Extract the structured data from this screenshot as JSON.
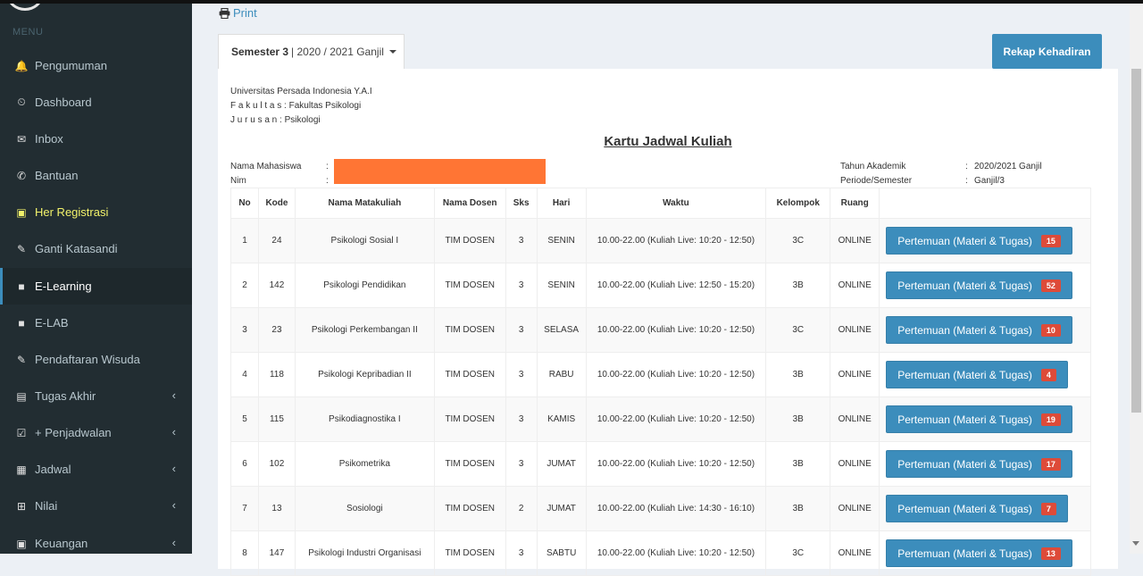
{
  "sidebar": {
    "header": "MENU",
    "items": [
      {
        "label": "Pengumuman",
        "icon": "bell-icon",
        "glyph": "🔔"
      },
      {
        "label": "Dashboard",
        "icon": "dashboard-icon",
        "glyph": "⏲"
      },
      {
        "label": "Inbox",
        "icon": "envelope-icon",
        "glyph": "✉"
      },
      {
        "label": "Bantuan",
        "icon": "phone-icon",
        "glyph": "✆"
      },
      {
        "label": "Her Registrasi",
        "icon": "money-icon",
        "glyph": "▣"
      },
      {
        "label": "Ganti Katasandi",
        "icon": "pencil-icon",
        "glyph": "✎"
      },
      {
        "label": "E-Learning",
        "icon": "video-camera-icon",
        "glyph": "■"
      },
      {
        "label": "E-LAB",
        "icon": "video-camera-icon",
        "glyph": "■"
      },
      {
        "label": "Pendaftaran Wisuda",
        "icon": "pencil-icon",
        "glyph": "✎"
      },
      {
        "label": "Tugas Akhir",
        "icon": "book-icon",
        "glyph": "▤"
      },
      {
        "label": "+ Penjadwalan",
        "icon": "calendar-check-icon",
        "glyph": "☑"
      },
      {
        "label": "Jadwal",
        "icon": "calendar-icon",
        "glyph": "▦"
      },
      {
        "label": "Nilai",
        "icon": "table-icon",
        "glyph": "⊞"
      },
      {
        "label": "Keuangan",
        "icon": "money-icon",
        "glyph": "▣"
      }
    ]
  },
  "toolbar": {
    "print_label": "Print",
    "rekap_label": "Rekap Kehadiran"
  },
  "semester_tab": {
    "semester": "Semester 3",
    "period": "| 2020 / 2021 Ganjil"
  },
  "university": {
    "name": "Universitas Persada Indonesia Y.A.I",
    "fakultas_label": "F a k u l t a s",
    "fakultas_value": ": Fakultas Psikologi",
    "jurusan_label": "J u r u s a n",
    "jurusan_value": ": Psikologi"
  },
  "card_title": "Kartu Jadwal Kuliah",
  "student": {
    "nama_label": "Nama Mahasiswa",
    "nim_label": "Nim",
    "colon": ":",
    "tahun_label": "Tahun Akademik",
    "tahun_value": "2020/2021 Ganjil",
    "periode_label": "Periode/Semester",
    "periode_value": "Ganjil/3"
  },
  "table": {
    "headers": [
      "No",
      "Kode",
      "Nama Matakuliah",
      "Nama Dosen",
      "Sks",
      "Hari",
      "Waktu",
      "Kelompok",
      "Ruang",
      ""
    ],
    "button_label": "Pertemuan (Materi & Tugas)",
    "rows": [
      {
        "no": "1",
        "kode": "24",
        "nama": "Psikologi Sosial I",
        "dosen": "TIM DOSEN",
        "sks": "3",
        "hari": "SENIN",
        "waktu": "10.00-22.00 (Kuliah Live: 10:20 - 12:50)",
        "kelompok": "3C",
        "ruang": "ONLINE",
        "badge": "15"
      },
      {
        "no": "2",
        "kode": "142",
        "nama": "Psikologi Pendidikan",
        "dosen": "TIM DOSEN",
        "sks": "3",
        "hari": "SENIN",
        "waktu": "10.00-22.00 (Kuliah Live: 12:50 - 15:20)",
        "kelompok": "3B",
        "ruang": "ONLINE",
        "badge": "52"
      },
      {
        "no": "3",
        "kode": "23",
        "nama": "Psikologi Perkembangan II",
        "dosen": "TIM DOSEN",
        "sks": "3",
        "hari": "SELASA",
        "waktu": "10.00-22.00 (Kuliah Live: 10:20 - 12:50)",
        "kelompok": "3C",
        "ruang": "ONLINE",
        "badge": "10"
      },
      {
        "no": "4",
        "kode": "118",
        "nama": "Psikologi Kepribadian II",
        "dosen": "TIM DOSEN",
        "sks": "3",
        "hari": "RABU",
        "waktu": "10.00-22.00 (Kuliah Live: 10:20 - 12:50)",
        "kelompok": "3B",
        "ruang": "ONLINE",
        "badge": "4"
      },
      {
        "no": "5",
        "kode": "115",
        "nama": "Psikodiagnostika I",
        "dosen": "TIM DOSEN",
        "sks": "3",
        "hari": "KAMIS",
        "waktu": "10.00-22.00 (Kuliah Live: 10:20 - 12:50)",
        "kelompok": "3B",
        "ruang": "ONLINE",
        "badge": "19"
      },
      {
        "no": "6",
        "kode": "102",
        "nama": "Psikometrika",
        "dosen": "TIM DOSEN",
        "sks": "3",
        "hari": "JUMAT",
        "waktu": "10.00-22.00 (Kuliah Live: 10:20 - 12:50)",
        "kelompok": "3B",
        "ruang": "ONLINE",
        "badge": "17"
      },
      {
        "no": "7",
        "kode": "13",
        "nama": "Sosiologi",
        "dosen": "TIM DOSEN",
        "sks": "2",
        "hari": "JUMAT",
        "waktu": "10.00-22.00 (Kuliah Live: 14:30 - 16:10)",
        "kelompok": "3B",
        "ruang": "ONLINE",
        "badge": "7"
      },
      {
        "no": "8",
        "kode": "147",
        "nama": "Psikologi Industri Organisasi",
        "dosen": "TIM DOSEN",
        "sks": "3",
        "hari": "SABTU",
        "waktu": "10.00-22.00 (Kuliah Live: 10:20 - 12:50)",
        "kelompok": "3C",
        "ruang": "ONLINE",
        "badge": "13"
      }
    ]
  },
  "colors": {
    "sidebar_bg": "#222d32",
    "accent": "#3c8dbc",
    "badge": "#dd4b39",
    "redaction": "#ff7534",
    "highlight": "#f3f36b"
  }
}
